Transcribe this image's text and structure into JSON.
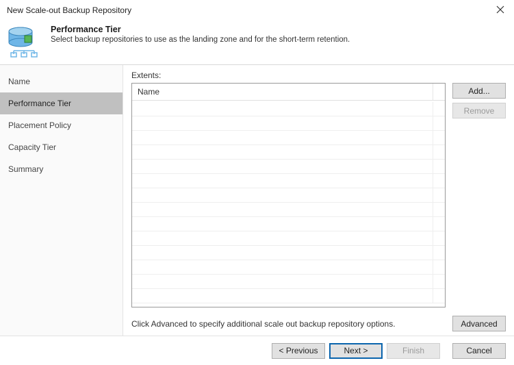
{
  "window": {
    "title": "New Scale-out Backup Repository"
  },
  "header": {
    "title": "Performance Tier",
    "description": "Select backup repositories to use as the landing zone and for the short-term retention."
  },
  "sidebar": {
    "items": [
      {
        "label": "Name"
      },
      {
        "label": "Performance Tier"
      },
      {
        "label": "Placement Policy"
      },
      {
        "label": "Capacity Tier"
      },
      {
        "label": "Summary"
      }
    ],
    "active_index": 1
  },
  "content": {
    "extents_label": "Extents:",
    "grid_header": "Name",
    "add_label": "Add...",
    "remove_label": "Remove",
    "hint": "Click Advanced to specify additional scale out backup repository options.",
    "advanced_label": "Advanced"
  },
  "footer": {
    "previous": "< Previous",
    "next": "Next >",
    "finish": "Finish",
    "cancel": "Cancel"
  }
}
